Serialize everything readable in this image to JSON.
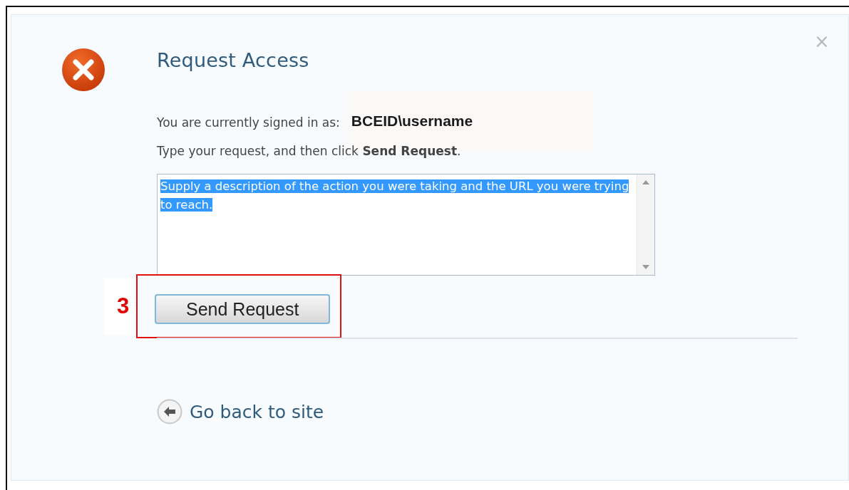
{
  "dialog": {
    "title": "Request Access",
    "close": "×",
    "signed_in": {
      "label": "You are currently signed in as:",
      "username": "BCEID\\username"
    },
    "instruction": "Type your request, and then click **Send Request**.",
    "request_field": {
      "value": "Supply a description of the action you were taking and the URL you were trying to reach.",
      "highlighted": true
    },
    "send_button": "Send Request",
    "back_link": "Go back to site"
  },
  "annotation": {
    "label": "3"
  }
}
